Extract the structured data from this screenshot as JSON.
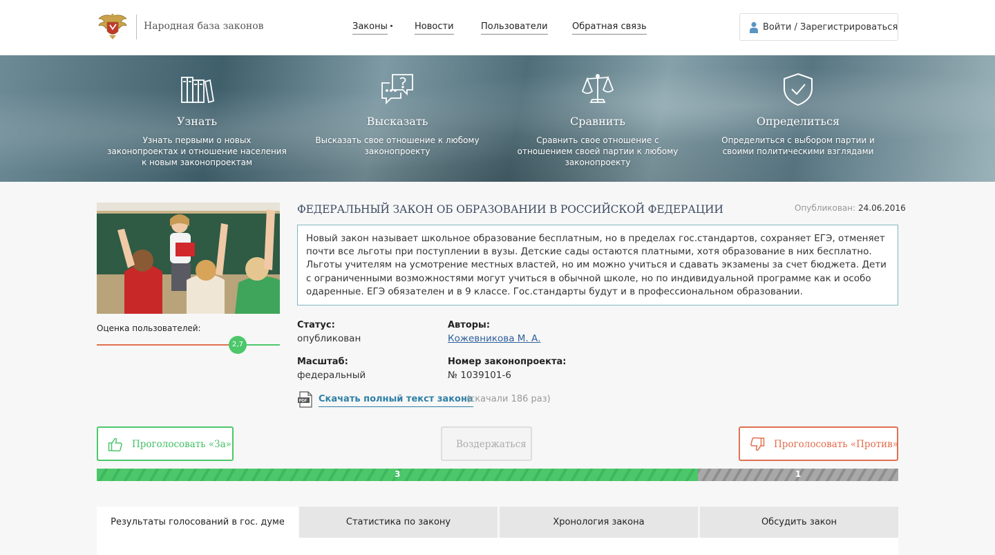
{
  "header": {
    "site_name": "Народная база законов",
    "nav": [
      {
        "label": "Законы"
      },
      {
        "label": "Новости"
      },
      {
        "label": "Пользователи"
      },
      {
        "label": "Обратная связь"
      }
    ],
    "login_label": "Войти / Зарегистрироваться",
    "login_icon": "user-icon",
    "logo_icon": "coat-of-arms-icon"
  },
  "features": [
    {
      "icon": "books-icon",
      "title": "Узнать",
      "description": "Узнать первыми о новых законопроектах и отношение населения к новым законопроектам"
    },
    {
      "icon": "chat-question-icon",
      "title": "Высказать",
      "description": "Высказать свое отношение к любому законопроекту"
    },
    {
      "icon": "scales-icon",
      "title": "Сравнить",
      "description": "Сравнить свое отношение с отношением своей партии к любому законопроекту"
    },
    {
      "icon": "shield-check-icon",
      "title": "Определиться",
      "description": "Определиться с выбором партии и своими политическими взглядами"
    }
  ],
  "law": {
    "title": "ФЕДЕРАЛЬНЫЙ ЗАКОН ОБ ОБРАЗОВАНИИ В РОССИЙСКОЙ ФЕДЕРАЦИИ",
    "published_label": "Опубликован:",
    "published_date": "24.06.2016",
    "summary": "Новый закон называет школьное образование бесплатным, но в пределах гос.стандартов, сохраняет ЕГЭ, отменяет почти все льготы при поступлении в вузы. Детские сады остаются платными, хотя образование в них бесплатно. Льготы учителям на усмотрение местных властей, но им можно учиться и сдавать экзамены за счет бюджета. Дети с ограниченными возможностями могут учиться в обычной школе, но по индивидуальной программе как и особо одаренные. ЕГЭ обязателен и в 9 классе. Гос.стандарты будут и в профессиональном образовании.",
    "status_label": "Статус:",
    "status_value": "опубликован",
    "authors_label": "Авторы:",
    "authors_value": "Кожевникова М. А.",
    "scale_label": "Масштаб:",
    "scale_value": "федеральный",
    "number_label": "Номер законопроекта:",
    "number_value": "№ 1039101-6",
    "download_label": "Скачать полный текст закона",
    "download_count": "(скачали 186 раз)",
    "download_icon": "pdf-icon"
  },
  "rating": {
    "label": "Оценка пользователей:",
    "value": "2,7",
    "value_fraction": 0.77
  },
  "votes": {
    "for_label": "Проголосовать «За»",
    "abstain_label": "Воздержаться",
    "against_label": "Проголосовать «Против»",
    "for_icon": "thumbs-up-icon",
    "against_icon": "thumbs-down-icon",
    "for_count": "3",
    "against_count": "1",
    "for_fraction": 0.75
  },
  "tabs": [
    {
      "label": "Результаты голосований в гос. думе",
      "active": true
    },
    {
      "label": "Статистика по закону",
      "active": false
    },
    {
      "label": "Хронология закона",
      "active": false
    },
    {
      "label": "Обсудить закон",
      "active": false
    }
  ],
  "colors": {
    "accent_green": "#4cc76a",
    "accent_red": "#e07050",
    "title_blue": "#3e4c63",
    "link_blue": "#2e7fa6"
  }
}
